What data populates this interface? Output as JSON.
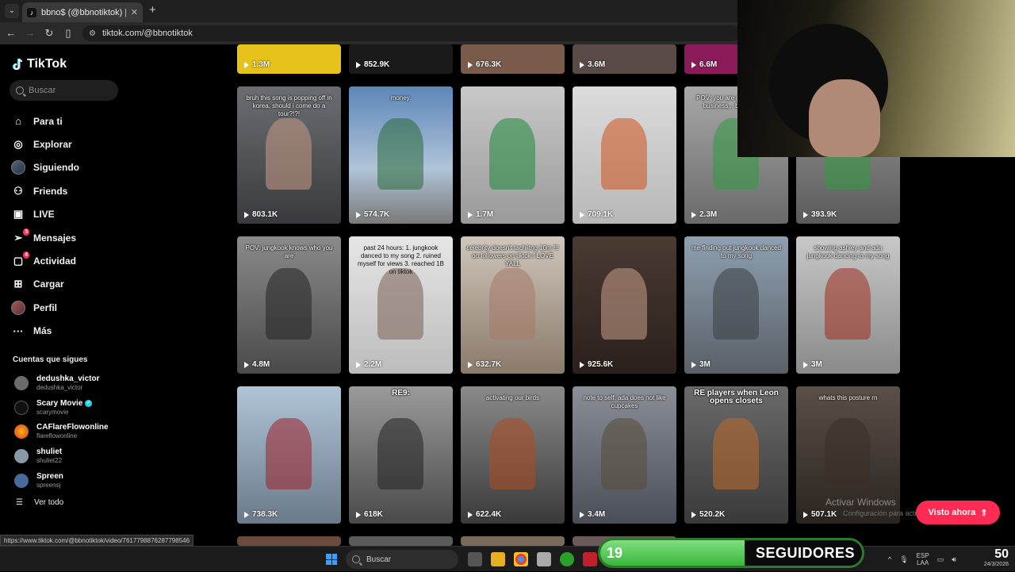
{
  "browser": {
    "tab_title": "bbno$ (@bbnotiktok) | TikTok",
    "url": "tiktok.com/@bbnotiktok",
    "status_url": "https://www.tiktok.com/@bbnotiktok/video/7617798876287798546"
  },
  "sidebar": {
    "logo": "TikTok",
    "search_placeholder": "Buscar",
    "menu": [
      {
        "label": "Para ti",
        "icon": "home-icon"
      },
      {
        "label": "Explorar",
        "icon": "compass-icon"
      },
      {
        "label": "Siguiendo",
        "icon": "following-avatar"
      },
      {
        "label": "Friends",
        "icon": "friends-icon"
      },
      {
        "label": "LIVE",
        "icon": "live-icon"
      },
      {
        "label": "Mensajes",
        "icon": "messages-icon",
        "badge": "3"
      },
      {
        "label": "Actividad",
        "icon": "activity-icon",
        "badge": "4"
      },
      {
        "label": "Cargar",
        "icon": "upload-icon"
      },
      {
        "label": "Perfil",
        "icon": "profile-avatar"
      },
      {
        "label": "Más",
        "icon": "more-icon"
      }
    ],
    "following_title": "Cuentas que sigues",
    "following": [
      {
        "name": "dedushka_victor",
        "handle": "dedushka_victor",
        "verified": false
      },
      {
        "name": "Scary Movie",
        "handle": "scarymovie",
        "verified": true
      },
      {
        "name": "CAFlareFlowonline",
        "handle": "flareflowonline",
        "verified": false
      },
      {
        "name": "shuliet",
        "handle": "shuliet22",
        "verified": false
      },
      {
        "name": "Spreen",
        "handle": "spreensj",
        "verified": false
      }
    ],
    "see_all": "Ver todo"
  },
  "videos": {
    "row0": [
      "1.3M",
      "852.9K",
      "676.3K",
      "3.6M",
      "6.6M"
    ],
    "row1": [
      {
        "views": "803.1K",
        "caption": "bruh this song is popping off in korea, should i come do a tour?!?!"
      },
      {
        "views": "574.7K",
        "caption": "money."
      },
      {
        "views": "1.7M",
        "caption": ""
      },
      {
        "views": "709.1K",
        "caption": ""
      },
      {
        "views": "2.3M",
        "caption": "POV: you are greatest in the business... but life is for"
      },
      {
        "views": "393.9K",
        "caption": ""
      }
    ],
    "row2": [
      {
        "views": "4.8M",
        "caption": "POV: jungkook knows who you are"
      },
      {
        "views": "2.2M",
        "caption": "past 24 hours: 1. jungkook danced to my song 2. ruined myself for views 3. reached 1B on tiktok"
      },
      {
        "views": "632.7K",
        "caption": "celebrity doesn't tachiitng 10m !!! on followers on tiktok I LOVE YALL"
      },
      {
        "views": "925.6K",
        "caption": ""
      },
      {
        "views": "3M",
        "caption": "me finding out jungkook danced to my song"
      },
      {
        "views": "3M",
        "caption": "showing ashley and ada jungkook dancing to my song"
      }
    ],
    "row3": [
      {
        "views": "738.3K",
        "caption": ""
      },
      {
        "views": "618K",
        "caption": "RE9:"
      },
      {
        "views": "622.4K",
        "caption": "activating our birds"
      },
      {
        "views": "3.4M",
        "caption": "note to self: ada does not like cupcakes"
      },
      {
        "views": "520.2K",
        "caption": "RE players when Leon opens closets"
      },
      {
        "views": "507.1K",
        "caption": "whats this posture rn"
      }
    ]
  },
  "overlay": {
    "visto_ahora": "Visto ahora",
    "activate_windows": "Activar Windows",
    "activate_sub": "Configuración para activar Windows"
  },
  "followers_widget": {
    "count": "19",
    "label": "SEGUIDORES",
    "progress": 0.55
  },
  "taskbar": {
    "search": "Buscar",
    "lang_top": "ESP",
    "lang_bottom": "LAA",
    "time": "50",
    "date": "24/3/2026"
  },
  "colors": {
    "accent": "#fe2c55",
    "background": "#000000"
  }
}
